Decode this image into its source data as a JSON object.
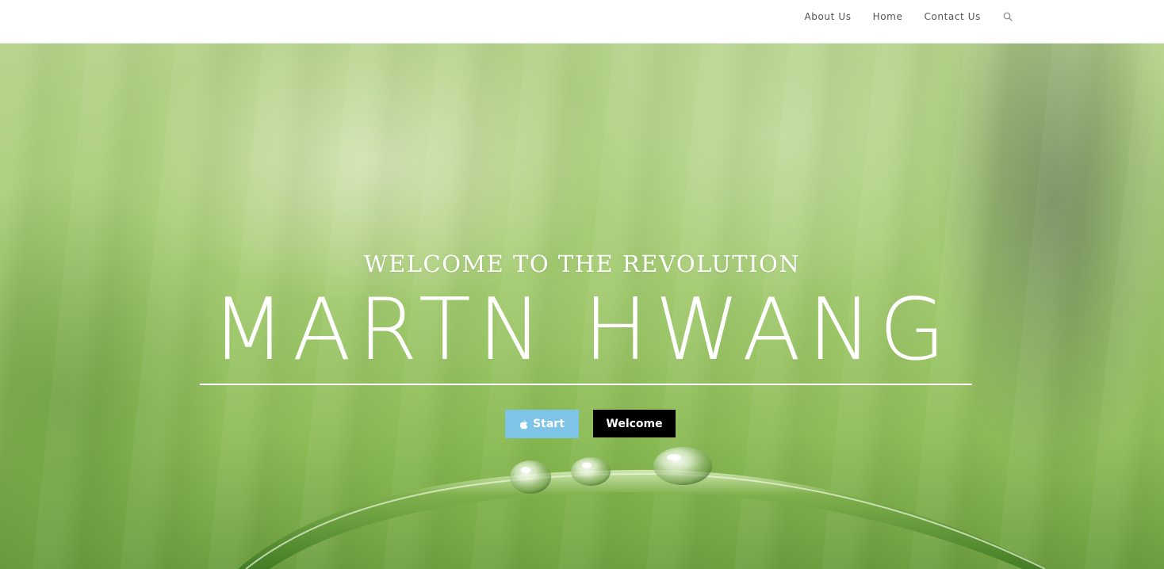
{
  "header": {
    "nav": [
      {
        "label": "About Us"
      },
      {
        "label": "Home"
      },
      {
        "label": "Contact Us"
      }
    ],
    "search_icon": "search-icon"
  },
  "hero": {
    "subtitle": "WELCOME TO THE REVOLUTION",
    "headline": "MARTN HWANG",
    "buttons": {
      "start_label": "Start",
      "start_icon": "apple-icon",
      "welcome_label": "Welcome"
    },
    "background_image": "blurred green grass blade with water droplets"
  },
  "colors": {
    "nav_text": "#555555",
    "start_button": "#7ec4e6",
    "welcome_button": "#000000",
    "hero_text": "#ffffff"
  }
}
